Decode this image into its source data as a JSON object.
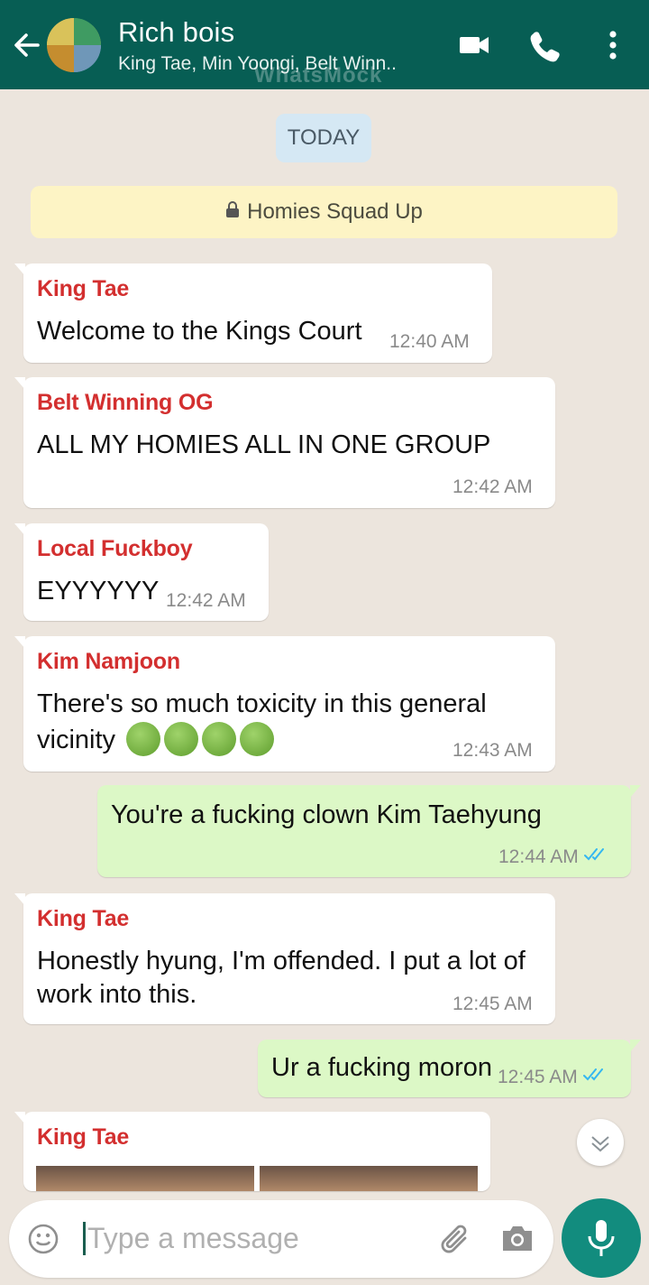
{
  "header": {
    "title": "Rich bois",
    "subtitle": "King Tae, Min Yoongi, Belt Winn..",
    "watermark": "WhatsMock"
  },
  "date_divider": "TODAY",
  "group_notice": "Homies Squad Up",
  "messages": [
    {
      "sender": "King Tae",
      "text": "Welcome to the Kings Court",
      "time": "12:40 AM"
    },
    {
      "sender": "Belt Winning OG",
      "text": "ALL MY HOMIES ALL IN ONE GROUP",
      "time": "12:42 AM"
    },
    {
      "sender": "Local Fuckboy",
      "text": "EYYYYYY",
      "time": "12:42 AM"
    },
    {
      "sender": "Kim Namjoon",
      "text_line1": "There's so much toxicity in this general",
      "text_line2": "vicinity",
      "emoji_count": 4,
      "time": "12:43 AM"
    },
    {
      "outgoing": true,
      "text": "You're a fucking clown Kim Taehyung",
      "time": "12:44 AM",
      "status": "read"
    },
    {
      "sender": "King Tae",
      "text_line1": "Honestly hyung, I'm offended. I put a lot of",
      "text_line2": "work into this.",
      "time": "12:45 AM"
    },
    {
      "outgoing": true,
      "text": "Ur a fucking moron",
      "time": "12:45 AM",
      "status": "read"
    },
    {
      "sender": "King Tae",
      "media": "photos"
    }
  ],
  "composer": {
    "placeholder": "Type a message"
  },
  "colors": {
    "header": "#075e54",
    "sender_name": "#d32f2f",
    "outgoing_bubble": "#dcf8c6",
    "read_ticks": "#34b7f1",
    "mic_button": "#128c7e"
  },
  "icons": [
    "back-arrow-icon",
    "video-call-icon",
    "voice-call-icon",
    "more-options-icon",
    "lock-icon",
    "emoji-icon",
    "attach-icon",
    "camera-icon",
    "mic-icon",
    "chevron-down-icon",
    "read-ticks-icon"
  ]
}
